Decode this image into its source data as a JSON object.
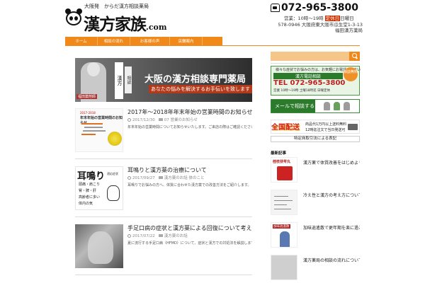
{
  "header": {
    "tagline": "大阪発　からだ漢方相談薬局",
    "logo_name": "漢方家族",
    "logo_suffix": ".com",
    "phone": "072-965-3800",
    "hours": "営業：10時～19時",
    "closed_label": "定休日",
    "closed_days": "日曜日",
    "address": "578-0946 大阪府東大阪市瓜生堂1-3-13",
    "shop_name": "福田漢方薬局"
  },
  "nav": {
    "items": [
      {
        "label": "ホーム"
      },
      {
        "label": "相談の流れ"
      },
      {
        "label": "お客様の声"
      },
      {
        "label": "店舗案内"
      }
    ]
  },
  "hero": {
    "badge": "福田薬剤師",
    "sign_left": "漢方",
    "sign_right": "相談",
    "title": "大阪の漢方相談専門薬局",
    "subtitle": "あなたの悩みを解決するお手伝いを致します"
  },
  "posts": [
    {
      "title": "2017年〜2018年年末年始の営業時間のお知らせ",
      "date": "2017/12/30",
      "category": "07 営業のお知らせ",
      "excerpt": "年末年始の営業時間についてお知らせいたします。ご来店の際はご確認ください。 ...",
      "thumb_line1": "2017-2018",
      "thumb_line2": "年末年始の営業時間のお知らせ"
    },
    {
      "title": "耳鳴りと漢方薬の治療について",
      "date": "2017/09/27",
      "category": "漢方薬のお話 体のこと",
      "excerpt": "耳鳴りでお悩みの方へ、体質に合わせた漢方薬での改善方法をご紹介します。 ...",
      "thumb_big": "耳鳴り",
      "thumb_small": "適応症状",
      "thumb_lines": [
        "頭痛・肩こり",
        "腎・脾・肝",
        "高齢者に多い",
        "体内の気"
      ]
    },
    {
      "title": "手足口病の症状と漢方薬による回復について考える",
      "date": "2017/07/22",
      "category": "漢方薬のお話",
      "excerpt": "夏に流行する手足口病（HFMD）について、症状と漢方での対処法を解説します。 ...",
      "thumb_big": "",
      "thumb_small": "",
      "thumb_lines": []
    }
  ],
  "sidebar": {
    "search_placeholder": "",
    "tel_banner": {
      "question": "様々な症状でお悩みの方は、お気軽にお電話ください",
      "head": "漢方電話相談",
      "number": "TEL 072-965-3800",
      "hours": "営業 10時〜19時 土曜18時迄 日曜定休",
      "free": "相談無料"
    },
    "mail_banner": "メールで相談する",
    "ship_banner": {
      "big": "全国配送",
      "line1": "商品代1万円以上送料無料",
      "line2": "12時迄注文で当日発送可"
    },
    "law_link": "特定商取引法による表記",
    "recent_heading": "最新記事",
    "recent_posts": [
      {
        "title": "漢方薬で体質改善をはじめよう",
        "thumb_label": "桂枝茯苓丸"
      },
      {
        "title": "冷え性と漢方の考え方について",
        "thumb_label": ""
      },
      {
        "title": "加味逍遙散で更年期を楽に過ごす",
        "thumb_label": "加味逍遙散"
      },
      {
        "title": "漢方薬局の相談の流れについて",
        "thumb_label": ""
      }
    ]
  },
  "colors": {
    "accent": "#f0891a",
    "green": "#2c7a2b",
    "red": "#d42020"
  }
}
